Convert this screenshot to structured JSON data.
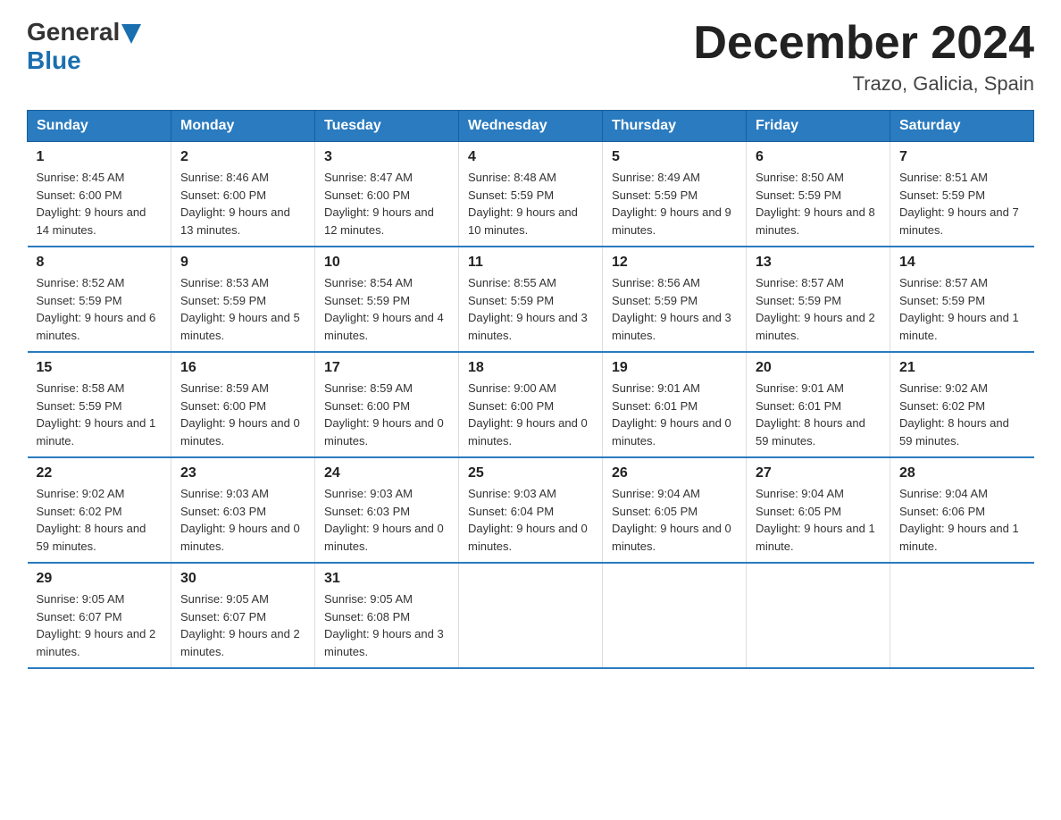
{
  "logo": {
    "general": "General",
    "arrow": "▶",
    "blue": "Blue"
  },
  "title": "December 2024",
  "location": "Trazo, Galicia, Spain",
  "days_of_week": [
    "Sunday",
    "Monday",
    "Tuesday",
    "Wednesday",
    "Thursday",
    "Friday",
    "Saturday"
  ],
  "weeks": [
    [
      {
        "day": "1",
        "sunrise": "8:45 AM",
        "sunset": "6:00 PM",
        "daylight": "9 hours and 14 minutes."
      },
      {
        "day": "2",
        "sunrise": "8:46 AM",
        "sunset": "6:00 PM",
        "daylight": "9 hours and 13 minutes."
      },
      {
        "day": "3",
        "sunrise": "8:47 AM",
        "sunset": "6:00 PM",
        "daylight": "9 hours and 12 minutes."
      },
      {
        "day": "4",
        "sunrise": "8:48 AM",
        "sunset": "5:59 PM",
        "daylight": "9 hours and 10 minutes."
      },
      {
        "day": "5",
        "sunrise": "8:49 AM",
        "sunset": "5:59 PM",
        "daylight": "9 hours and 9 minutes."
      },
      {
        "day": "6",
        "sunrise": "8:50 AM",
        "sunset": "5:59 PM",
        "daylight": "9 hours and 8 minutes."
      },
      {
        "day": "7",
        "sunrise": "8:51 AM",
        "sunset": "5:59 PM",
        "daylight": "9 hours and 7 minutes."
      }
    ],
    [
      {
        "day": "8",
        "sunrise": "8:52 AM",
        "sunset": "5:59 PM",
        "daylight": "9 hours and 6 minutes."
      },
      {
        "day": "9",
        "sunrise": "8:53 AM",
        "sunset": "5:59 PM",
        "daylight": "9 hours and 5 minutes."
      },
      {
        "day": "10",
        "sunrise": "8:54 AM",
        "sunset": "5:59 PM",
        "daylight": "9 hours and 4 minutes."
      },
      {
        "day": "11",
        "sunrise": "8:55 AM",
        "sunset": "5:59 PM",
        "daylight": "9 hours and 3 minutes."
      },
      {
        "day": "12",
        "sunrise": "8:56 AM",
        "sunset": "5:59 PM",
        "daylight": "9 hours and 3 minutes."
      },
      {
        "day": "13",
        "sunrise": "8:57 AM",
        "sunset": "5:59 PM",
        "daylight": "9 hours and 2 minutes."
      },
      {
        "day": "14",
        "sunrise": "8:57 AM",
        "sunset": "5:59 PM",
        "daylight": "9 hours and 1 minute."
      }
    ],
    [
      {
        "day": "15",
        "sunrise": "8:58 AM",
        "sunset": "5:59 PM",
        "daylight": "9 hours and 1 minute."
      },
      {
        "day": "16",
        "sunrise": "8:59 AM",
        "sunset": "6:00 PM",
        "daylight": "9 hours and 0 minutes."
      },
      {
        "day": "17",
        "sunrise": "8:59 AM",
        "sunset": "6:00 PM",
        "daylight": "9 hours and 0 minutes."
      },
      {
        "day": "18",
        "sunrise": "9:00 AM",
        "sunset": "6:00 PM",
        "daylight": "9 hours and 0 minutes."
      },
      {
        "day": "19",
        "sunrise": "9:01 AM",
        "sunset": "6:01 PM",
        "daylight": "9 hours and 0 minutes."
      },
      {
        "day": "20",
        "sunrise": "9:01 AM",
        "sunset": "6:01 PM",
        "daylight": "8 hours and 59 minutes."
      },
      {
        "day": "21",
        "sunrise": "9:02 AM",
        "sunset": "6:02 PM",
        "daylight": "8 hours and 59 minutes."
      }
    ],
    [
      {
        "day": "22",
        "sunrise": "9:02 AM",
        "sunset": "6:02 PM",
        "daylight": "8 hours and 59 minutes."
      },
      {
        "day": "23",
        "sunrise": "9:03 AM",
        "sunset": "6:03 PM",
        "daylight": "9 hours and 0 minutes."
      },
      {
        "day": "24",
        "sunrise": "9:03 AM",
        "sunset": "6:03 PM",
        "daylight": "9 hours and 0 minutes."
      },
      {
        "day": "25",
        "sunrise": "9:03 AM",
        "sunset": "6:04 PM",
        "daylight": "9 hours and 0 minutes."
      },
      {
        "day": "26",
        "sunrise": "9:04 AM",
        "sunset": "6:05 PM",
        "daylight": "9 hours and 0 minutes."
      },
      {
        "day": "27",
        "sunrise": "9:04 AM",
        "sunset": "6:05 PM",
        "daylight": "9 hours and 1 minute."
      },
      {
        "day": "28",
        "sunrise": "9:04 AM",
        "sunset": "6:06 PM",
        "daylight": "9 hours and 1 minute."
      }
    ],
    [
      {
        "day": "29",
        "sunrise": "9:05 AM",
        "sunset": "6:07 PM",
        "daylight": "9 hours and 2 minutes."
      },
      {
        "day": "30",
        "sunrise": "9:05 AM",
        "sunset": "6:07 PM",
        "daylight": "9 hours and 2 minutes."
      },
      {
        "day": "31",
        "sunrise": "9:05 AM",
        "sunset": "6:08 PM",
        "daylight": "9 hours and 3 minutes."
      },
      null,
      null,
      null,
      null
    ]
  ],
  "labels": {
    "sunrise": "Sunrise:",
    "sunset": "Sunset:",
    "daylight": "Daylight:"
  }
}
